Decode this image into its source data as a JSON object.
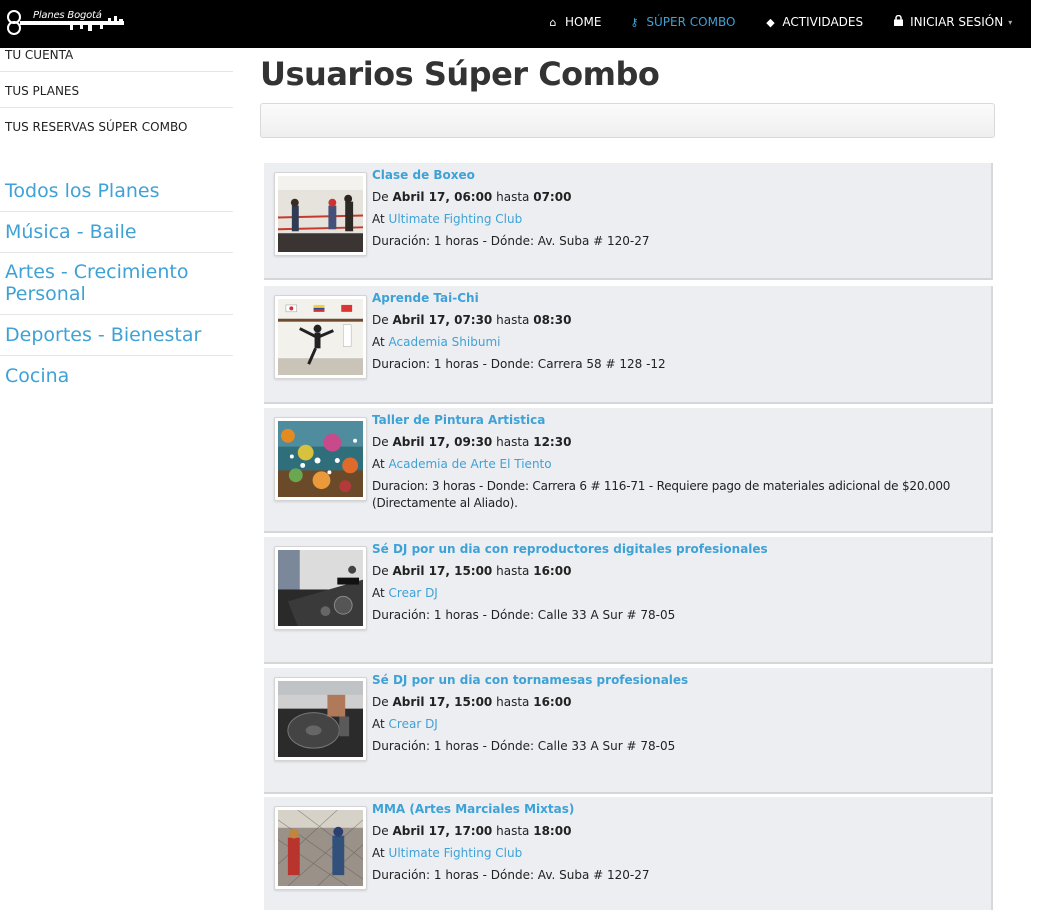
{
  "brand": {
    "logo_text": "Planes Bogotá"
  },
  "nav": {
    "home": "HOME",
    "combo": "SÚPER COMBO",
    "activities": "ACTIVIDADES",
    "login": "INICIAR SESIÓN",
    "active": "combo"
  },
  "sidebar": {
    "account_links": [
      "TU CUENTA",
      "TUS PLANES",
      "TUS RESERVAS SÚPER COMBO"
    ],
    "categories": [
      "Todos los Planes",
      "Música - Baile",
      "Artes - Crecimiento Personal",
      "Deportes - Bienestar",
      "Cocina"
    ]
  },
  "page": {
    "title": "Usuarios Súper Combo"
  },
  "labels": {
    "from": "De",
    "until": "hasta",
    "at": "At"
  },
  "events": [
    {
      "title": "Clase de Boxeo",
      "date": "Abril 17, 06:00",
      "end": "07:00",
      "venue": "Ultimate Fighting Club",
      "details": "Duración: 1 horas - Dónde: Av. Suba # 120-27",
      "image": "boxing-image"
    },
    {
      "title": "Aprende Tai-Chi",
      "date": "Abril 17, 07:30",
      "end": "08:30",
      "venue": "Academia Shibumi",
      "details": "Duracion: 1 horas - Donde: Carrera 58 # 128 -12",
      "image": "taichi-image"
    },
    {
      "title": "Taller de Pintura Artistica",
      "date": "Abril 17, 09:30",
      "end": "12:30",
      "venue": "Academia de Arte El Tiento",
      "details": "Duracion: 3 horas - Donde: Carrera 6 # 116-71 - Requiere pago de materiales adicional de $20.000 (Directamente al Aliado).",
      "image": "painting-image"
    },
    {
      "title": "Sé DJ por un dia con reproductores digitales profesionales",
      "date": "Abril 17, 15:00",
      "end": "16:00",
      "venue": "Crear DJ",
      "details": "Duración: 1 horas - Dónde: Calle 33 A Sur # 78-05",
      "image": "dj-controller-image"
    },
    {
      "title": "Sé DJ por un dia con tornamesas profesionales",
      "date": "Abril 17, 15:00",
      "end": "16:00",
      "venue": "Crear DJ",
      "details": "Duración: 1 horas - Dónde: Calle 33 A Sur # 78-05",
      "image": "turntable-image"
    },
    {
      "title": "MMA (Artes Marciales Mixtas)",
      "date": "Abril 17, 17:00",
      "end": "18:00",
      "venue": "Ultimate Fighting Club",
      "details": "Duración: 1 horas - Dónde: Av. Suba # 120-27",
      "image": "mma-image"
    }
  ]
}
